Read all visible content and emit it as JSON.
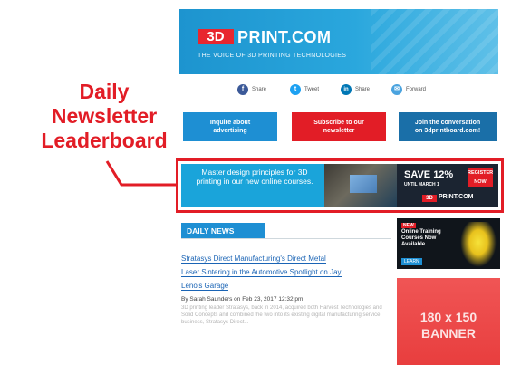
{
  "callout": {
    "lines": [
      "Daily",
      "Newsletter",
      "Leaderboard"
    ]
  },
  "header": {
    "logo_3d": "3D",
    "logo_text": "PRINT.COM",
    "tagline": "THE VOICE OF 3D PRINTING TECHNOLOGIES"
  },
  "social": [
    {
      "icon": "f",
      "label": "Share",
      "color": "#3b5998"
    },
    {
      "icon": "t",
      "label": "Tweet",
      "color": "#1da1f2"
    },
    {
      "icon": "in",
      "label": "Share",
      "color": "#0077b5"
    },
    {
      "icon": "✉",
      "label": "Forward",
      "color": "#4aa3df"
    }
  ],
  "buttons": [
    {
      "label": "Inquire about advertising",
      "color": "#1e8fd3"
    },
    {
      "label": "Subscribe to our newsletter",
      "color": "#e21d26"
    },
    {
      "label": "Join the conversation on 3dprintboard.com!",
      "color": "#1a6fa8"
    }
  ],
  "leaderboard": {
    "text": "Master design principles for 3D printing in our new online courses.",
    "save": "SAVE 12%",
    "until": "UNTIL MARCH 1",
    "register": "REGISTER NOW",
    "logo_3d": "3D",
    "logo_text": "PRINT.COM"
  },
  "news": {
    "section": "DAILY NEWS",
    "title_lines": [
      "Stratasys Direct Manufacturing's Direct Metal",
      "Laser Sintering in the Automotive Spotlight on Jay",
      "Leno's Garage"
    ],
    "byline": "By Sarah Saunders on Feb 23, 2017 12:32 pm",
    "excerpt": "3D printing leader Stratasys, back in 2014, acquired both Harvest Technologies and Solid Concepts and combined the two into its existing digital manufacturing service business, Stratasys Direct..."
  },
  "side_ads": {
    "ad1": {
      "badge": "NEW",
      "text": "Online Training Courses Now Available",
      "cta": "LEARN"
    },
    "ad2": {
      "text": "180 x 150 BANNER"
    }
  },
  "colors": {
    "accent_red": "#e21d26",
    "accent_blue": "#1e8fd3"
  }
}
